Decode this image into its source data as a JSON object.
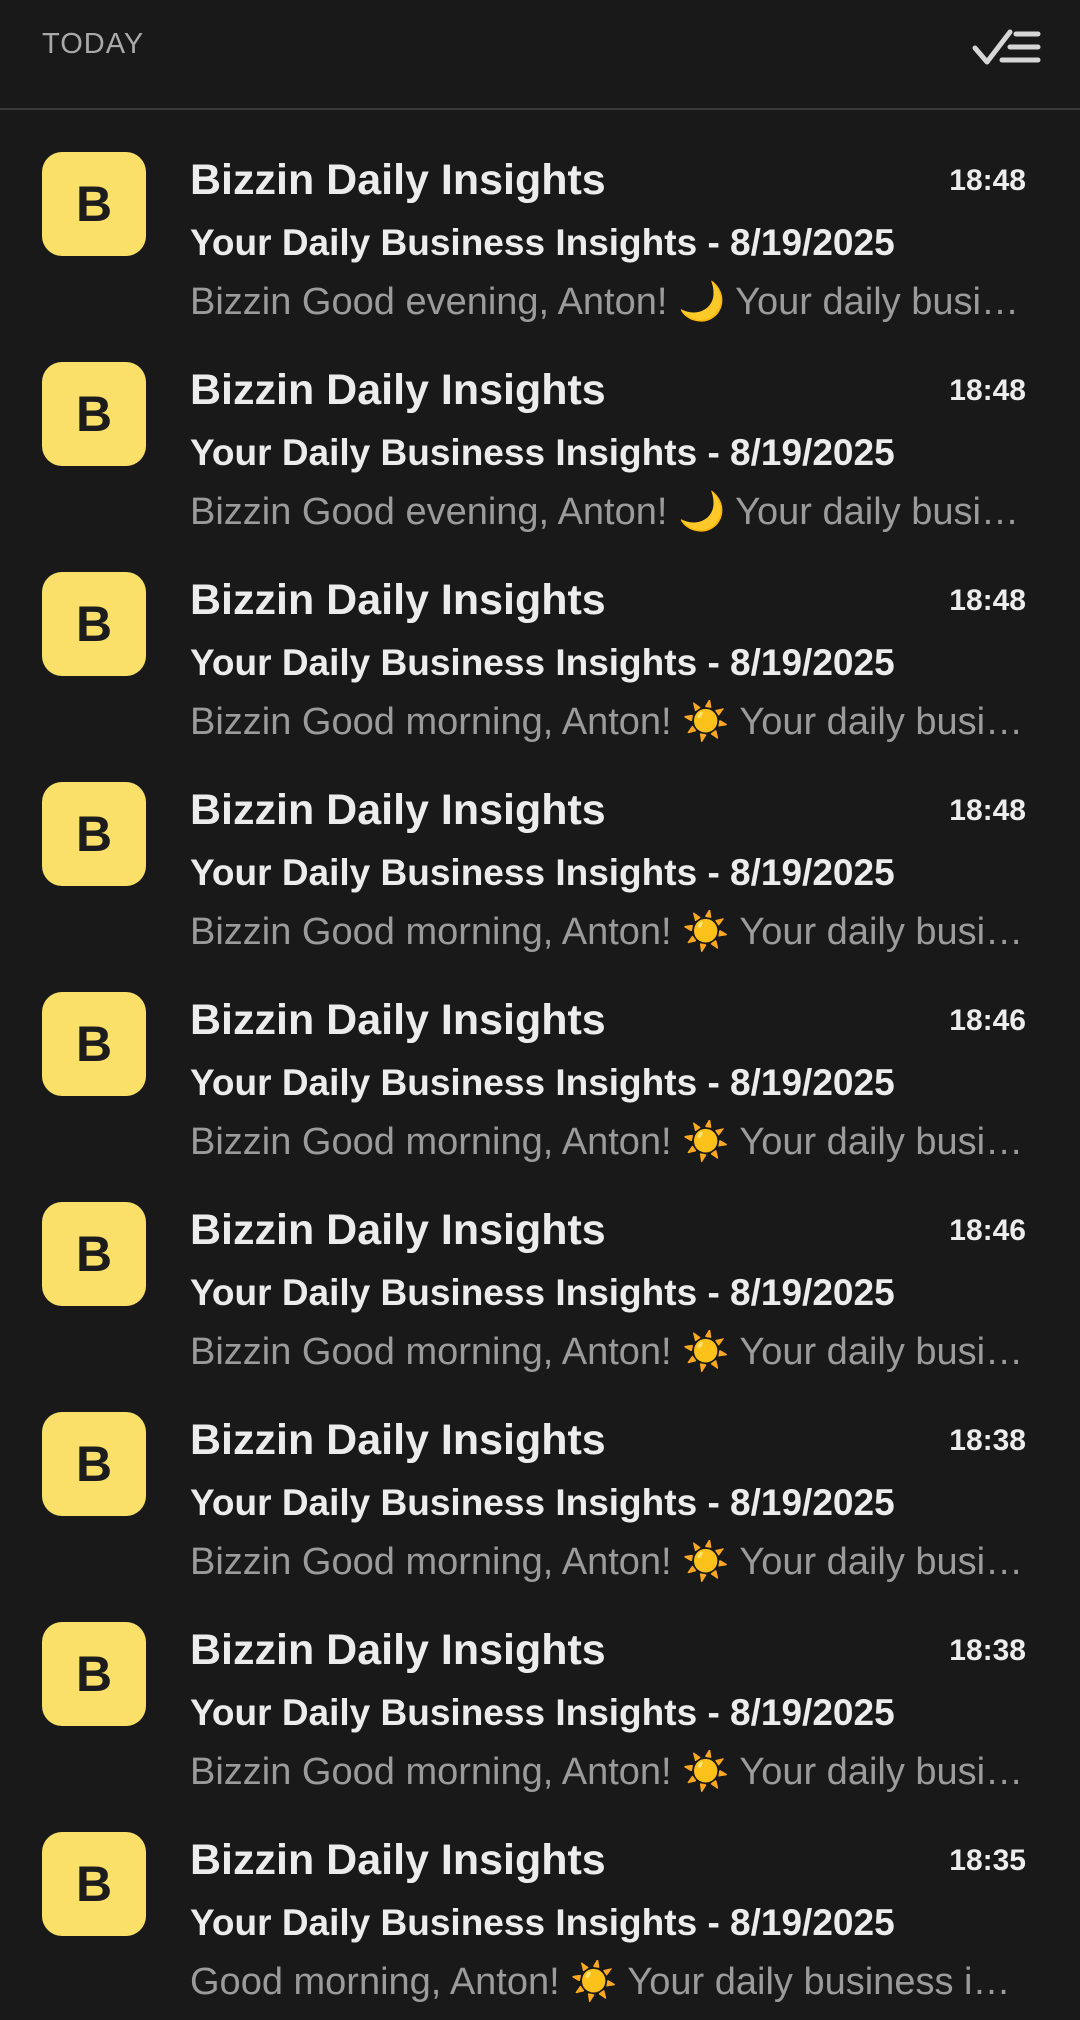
{
  "header": {
    "section_title": "TODAY",
    "mark_all_icon": "checklist-check-icon"
  },
  "colors": {
    "background": "#191919",
    "avatar": "#fadf68",
    "text_primary": "#ececec",
    "text_secondary": "#9b9b9b"
  },
  "messages": [
    {
      "avatar_letter": "B",
      "sender": "Bizzin Daily Insights",
      "time": "18:48",
      "subject": "Your Daily Business Insights - 8/19/2025",
      "preview": "Bizzin Good evening, Anton! 🌙 Your daily business insights are ready"
    },
    {
      "avatar_letter": "B",
      "sender": "Bizzin Daily Insights",
      "time": "18:48",
      "subject": "Your Daily Business Insights - 8/19/2025",
      "preview": "Bizzin Good evening, Anton! 🌙 Your daily business insights are ready"
    },
    {
      "avatar_letter": "B",
      "sender": "Bizzin Daily Insights",
      "time": "18:48",
      "subject": "Your Daily Business Insights - 8/19/2025",
      "preview": "Bizzin Good morning, Anton! ☀️ Your daily business insights are ready"
    },
    {
      "avatar_letter": "B",
      "sender": "Bizzin Daily Insights",
      "time": "18:48",
      "subject": "Your Daily Business Insights - 8/19/2025",
      "preview": "Bizzin Good morning, Anton! ☀️ Your daily business insights are ready"
    },
    {
      "avatar_letter": "B",
      "sender": "Bizzin Daily Insights",
      "time": "18:46",
      "subject": "Your Daily Business Insights - 8/19/2025",
      "preview": "Bizzin Good morning, Anton! ☀️ Your daily business insights are ready"
    },
    {
      "avatar_letter": "B",
      "sender": "Bizzin Daily Insights",
      "time": "18:46",
      "subject": "Your Daily Business Insights - 8/19/2025",
      "preview": "Bizzin Good morning, Anton! ☀️ Your daily business insights are ready"
    },
    {
      "avatar_letter": "B",
      "sender": "Bizzin Daily Insights",
      "time": "18:38",
      "subject": "Your Daily Business Insights - 8/19/2025",
      "preview": "Bizzin Good morning, Anton! ☀️ Your daily business insights are ready"
    },
    {
      "avatar_letter": "B",
      "sender": "Bizzin Daily Insights",
      "time": "18:38",
      "subject": "Your Daily Business Insights - 8/19/2025",
      "preview": "Bizzin Good morning, Anton! ☀️ Your daily business insights are ready"
    },
    {
      "avatar_letter": "B",
      "sender": "Bizzin Daily Insights",
      "time": "18:35",
      "subject": "Your Daily Business Insights - 8/19/2025",
      "preview": "Good morning, Anton! ☀️ Your daily business insights are ready"
    }
  ]
}
